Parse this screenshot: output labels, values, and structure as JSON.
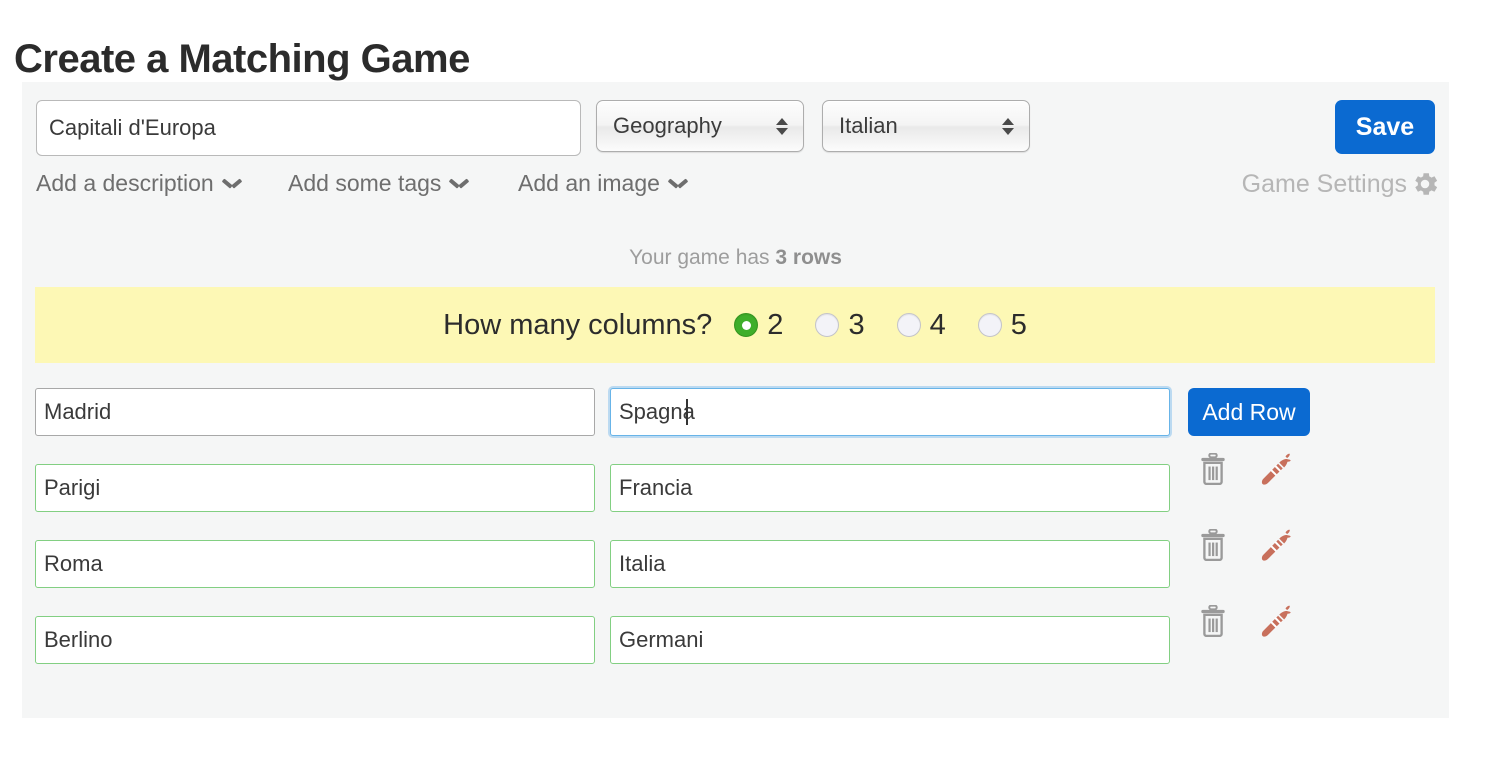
{
  "page": {
    "title": "Create a Matching Game"
  },
  "toolbar": {
    "game_title_value": "Capitali d'Europa",
    "game_title_placeholder": "",
    "subject_select": {
      "value": "Geography",
      "icon": "updown-arrows-icon"
    },
    "language_select": {
      "value": "Italian",
      "icon": "updown-arrows-icon"
    },
    "save_label": "Save",
    "save_color": "#0b6ad1"
  },
  "links": {
    "description": "Add a description",
    "tags": "Add some tags",
    "image": "Add an image",
    "chevron_icon": "chevron-down-icon",
    "game_settings": "Game Settings",
    "gear_icon": "gear-icon"
  },
  "rows_info": {
    "prefix": "Your game has ",
    "count_text": "3 rows"
  },
  "columns": {
    "question": "How many columns?",
    "banner_color": "#fdf8b5",
    "selected_value": "2",
    "selected_color": "#3fae2a",
    "options": [
      {
        "label": "2",
        "selected": true
      },
      {
        "label": "3",
        "selected": false
      },
      {
        "label": "4",
        "selected": false
      },
      {
        "label": "5",
        "selected": false
      }
    ]
  },
  "grid": {
    "add_row_label": "Add Row",
    "delete_icon": "trash-icon",
    "carrot_icon": "carrot-icon",
    "carrot_color": "#c8705c",
    "valid_border_color": "#82cf82",
    "focus_border_color": "#68b4e8",
    "rows": [
      {
        "cells": [
          {
            "value": "Madrid",
            "state": "default"
          },
          {
            "value": "Spagna",
            "state": "focused"
          }
        ],
        "has_add_button": true,
        "has_actions": false
      },
      {
        "cells": [
          {
            "value": "Parigi",
            "state": "valid"
          },
          {
            "value": "Francia",
            "state": "valid"
          }
        ],
        "has_add_button": false,
        "has_actions": true
      },
      {
        "cells": [
          {
            "value": "Roma",
            "state": "valid"
          },
          {
            "value": "Italia",
            "state": "valid"
          }
        ],
        "has_add_button": false,
        "has_actions": true
      },
      {
        "cells": [
          {
            "value": "Berlino",
            "state": "valid"
          },
          {
            "value": "Germani",
            "state": "valid"
          }
        ],
        "has_add_button": false,
        "has_actions": true
      }
    ]
  }
}
